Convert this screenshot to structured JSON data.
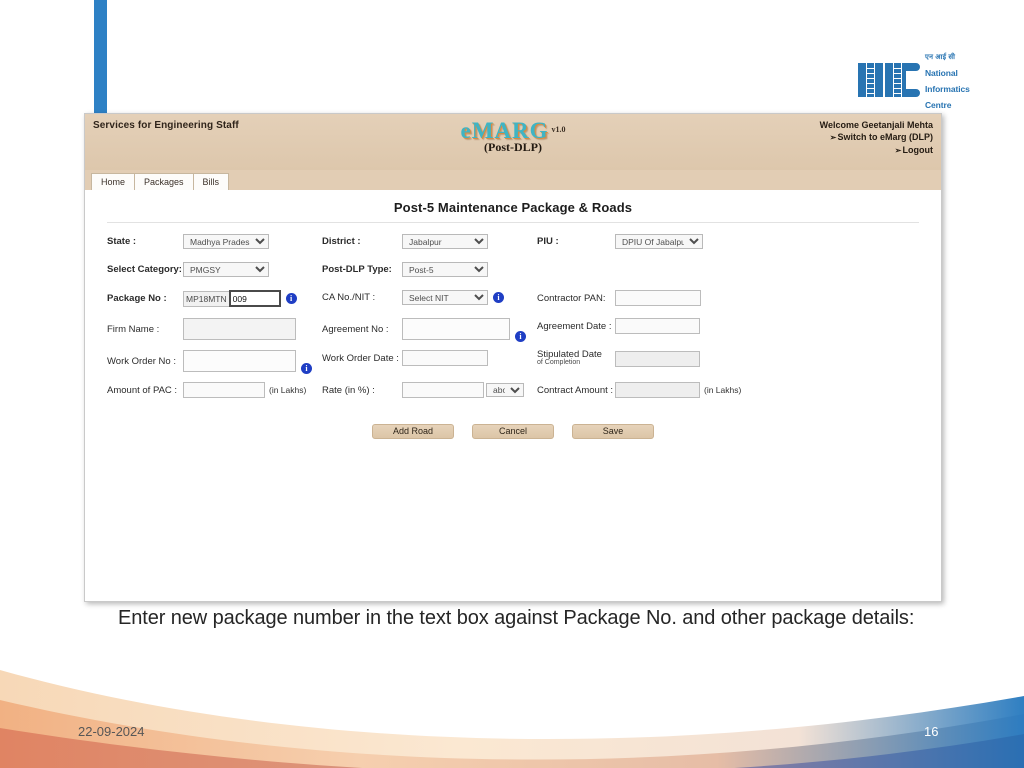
{
  "slide": {
    "caption_line1": "Enter new package number in the text box against Package No. and other",
    "caption_line2": "package details:",
    "footer_date": "22-09-2024",
    "page_number": "16",
    "accent_blue": "#2e81c5"
  },
  "logo": {
    "mark_text": "NIC",
    "hindi": "एन आई सी",
    "line1": "National",
    "line2": "Informatics",
    "line3": "Centre",
    "color": "#2874b2"
  },
  "app": {
    "services_label": "Services for Engineering Staff",
    "brand": "eMARG",
    "brand_version": "v1.0",
    "brand_sub": "(Post-DLP)",
    "welcome": "Welcome Geetanjali Mehta",
    "switch_link": "Switch to eMarg (DLP)",
    "logout_link": "Logout",
    "link_arrow": "➡",
    "tabs": [
      {
        "label": "Home"
      },
      {
        "label": "Packages"
      },
      {
        "label": "Bills"
      }
    ],
    "form_title": "Post-5 Maintenance Package & Roads",
    "fields": {
      "state_label": "State :",
      "state_value": "Madhya Pradesh",
      "district_label": "District :",
      "district_value": "Jabalpur",
      "piu_label": "PIU :",
      "piu_value": "DPIU Of Jabalpur",
      "category_label": "Select Category:",
      "category_value": "PMGSY",
      "postdlp_label": "Post-DLP Type:",
      "postdlp_value": "Post-5",
      "package_label": "Package No :",
      "package_prefix": "MP18MTN",
      "package_value": "009",
      "ca_nit_label": "CA No./NIT :",
      "ca_nit_value": "Select NIT",
      "contractor_pan_label": "Contractor PAN:",
      "contractor_pan_value": "",
      "firm_name_label": "Firm Name :",
      "firm_name_value": "",
      "agreement_no_label": "Agreement No :",
      "agreement_no_value": "",
      "agreement_date_label": "Agreement Date :",
      "agreement_date_value": "",
      "work_order_no_label": "Work Order No :",
      "work_order_no_value": "",
      "work_order_date_label": "Work Order Date :",
      "work_order_date_value": "",
      "stipulated_date_label": "Stipulated Date",
      "stipulated_date_sublabel": "of Completion",
      "stipulated_date_value": "",
      "amount_pac_label": "Amount of PAC :",
      "amount_pac_value": "",
      "amount_pac_unit": "(in Lakhs)",
      "rate_label": "Rate (in %) :",
      "rate_value": "",
      "rate_modifier": "above",
      "contract_amount_label": "Contract Amount :",
      "contract_amount_value": "",
      "contract_amount_unit": "(in Lakhs)"
    },
    "buttons": {
      "add_road": "Add Road",
      "cancel": "Cancel",
      "save": "Save"
    },
    "info_icon_glyph": "i"
  }
}
